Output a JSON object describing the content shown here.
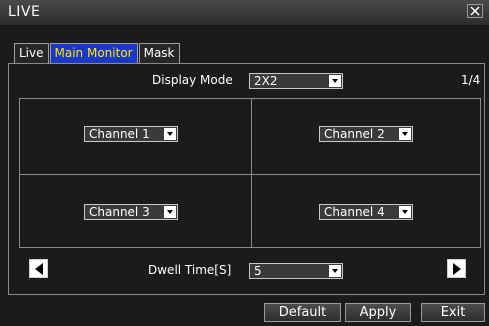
{
  "window": {
    "title": "LIVE"
  },
  "tabs": [
    {
      "label": "Live",
      "active": false
    },
    {
      "label": "Main Monitor",
      "active": true
    },
    {
      "label": "Mask",
      "active": false
    }
  ],
  "display_mode": {
    "label": "Display Mode",
    "value": "2X2"
  },
  "page_indicator": "1/4",
  "channels": [
    {
      "value": "Channel 1"
    },
    {
      "value": "Channel 2"
    },
    {
      "value": "Channel 3"
    },
    {
      "value": "Channel 4"
    }
  ],
  "dwell": {
    "label": "Dwell Time[S]",
    "value": "5"
  },
  "buttons": {
    "default": "Default",
    "apply": "Apply",
    "exit": "Exit"
  },
  "colors": {
    "active_tab_bg": "#1a38c8",
    "active_tab_text": "#ffe600",
    "background": "#1b1b1b"
  },
  "icons": {
    "close": "close-icon",
    "prev": "arrow-left-icon",
    "next": "arrow-right-icon"
  }
}
